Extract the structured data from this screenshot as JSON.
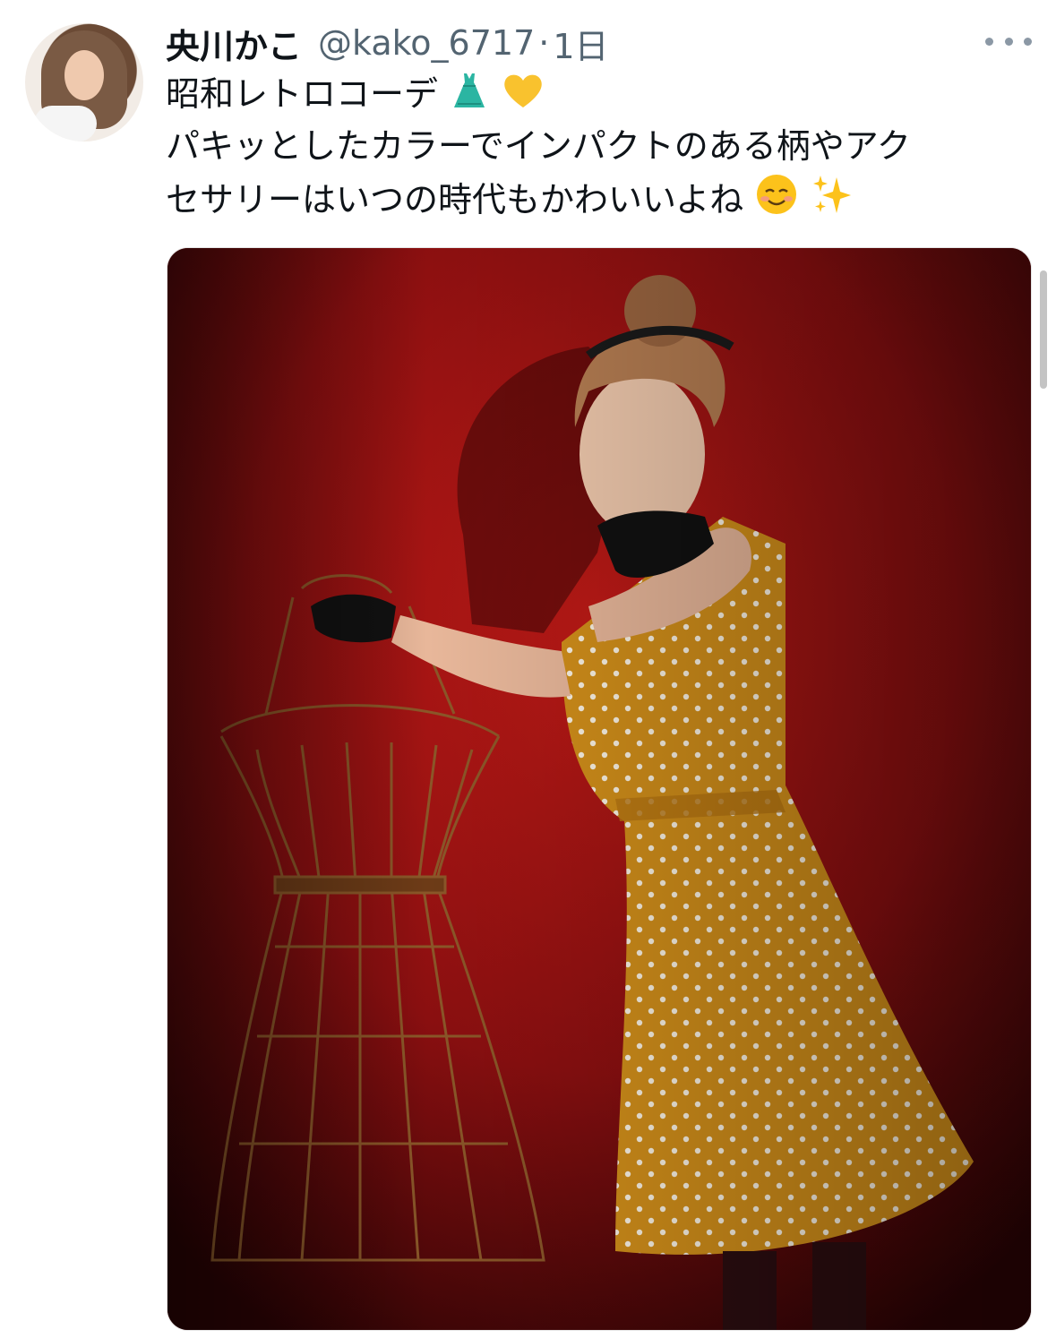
{
  "tweet": {
    "display_name": "央川かこ",
    "handle": "@kako_6717",
    "separator": "·",
    "timestamp": "1日",
    "text_lines": [
      "昭和レトロコーデ",
      "パキッとしたカラーでインパクトのある柄やアク",
      "セサリーはいつの時代もかわいいよね"
    ],
    "line1_emojis": [
      "dress-icon",
      "yellow-heart-icon"
    ],
    "line3_emojis": [
      "smiling-face-icon",
      "sparkles-icon"
    ]
  },
  "media": {
    "type": "photo",
    "description_icons": [
      "woman-in-yellow-polka-dot-dress",
      "wire-dress-form"
    ]
  },
  "colors": {
    "text": "#0f1419",
    "secondary": "#536471",
    "photo_background": "#8a0f10",
    "dress": "#d8951c"
  }
}
